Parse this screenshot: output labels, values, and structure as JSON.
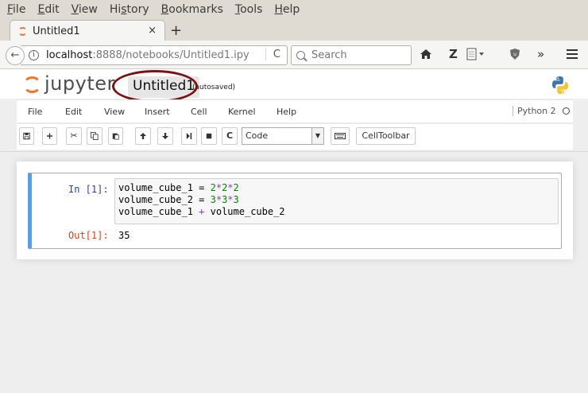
{
  "browser_menu": [
    {
      "pre": "",
      "ul": "F",
      "post": "ile"
    },
    {
      "pre": "",
      "ul": "E",
      "post": "dit"
    },
    {
      "pre": "",
      "ul": "V",
      "post": "iew"
    },
    {
      "pre": "Hi",
      "ul": "s",
      "post": "tory"
    },
    {
      "pre": "",
      "ul": "B",
      "post": "ookmarks"
    },
    {
      "pre": "",
      "ul": "T",
      "post": "ools"
    },
    {
      "pre": "",
      "ul": "H",
      "post": "elp"
    }
  ],
  "tab": {
    "title": "Untitled1",
    "close": "×",
    "new_tab": "+"
  },
  "navbar": {
    "back": "←",
    "url_host": "localhost",
    "url_rest": ":8888/notebooks/Untitled1.ipy",
    "reload": "C",
    "search_placeholder": "Search",
    "icons": [
      "home-icon",
      "zotero-icon",
      "reader-icon",
      "ublock-icon",
      "overflow-icon",
      "hamburger-menu-icon"
    ]
  },
  "jupyter": {
    "logo_text": "jupyter",
    "notebook_name": "Untitled1",
    "autosave_status": "(autosaved)"
  },
  "nb_menu": [
    "File",
    "Edit",
    "View",
    "Insert",
    "Cell",
    "Kernel",
    "Help"
  ],
  "kernel_name": "Python 2",
  "toolbar": {
    "cell_type": "Code",
    "celltoolbar_label": "CellToolbar"
  },
  "cell": {
    "in_prompt": "In [1]:",
    "out_prompt": "Out[1]:",
    "code": [
      [
        {
          "t": "volume_cube_1 = ",
          "c": ""
        },
        {
          "t": "2",
          "c": "num"
        },
        {
          "t": "*",
          "c": "op"
        },
        {
          "t": "2",
          "c": "num"
        },
        {
          "t": "*",
          "c": "op"
        },
        {
          "t": "2",
          "c": "num"
        }
      ],
      [
        {
          "t": "volume_cube_2 = ",
          "c": ""
        },
        {
          "t": "3",
          "c": "num"
        },
        {
          "t": "*",
          "c": "op"
        },
        {
          "t": "3",
          "c": "num"
        },
        {
          "t": "*",
          "c": "op"
        },
        {
          "t": "3",
          "c": "num"
        }
      ],
      [
        {
          "t": "volume_cube_1 ",
          "c": ""
        },
        {
          "t": "+",
          "c": "op"
        },
        {
          "t": " volume_cube_2",
          "c": ""
        }
      ]
    ],
    "output": "35"
  },
  "colors": {
    "accent_orange": "#f37626",
    "cell_border_active": "#42a5f5",
    "annotation_ring": "#7a1414"
  }
}
